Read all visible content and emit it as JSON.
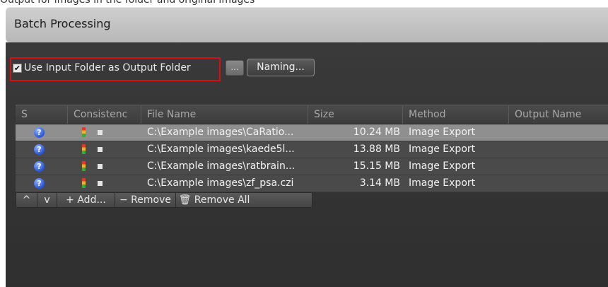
{
  "top_text": "Output for images in the folder and original images",
  "panel": {
    "title": "Batch Processing"
  },
  "options": {
    "checkbox_checked": true,
    "checkbox_label": "Use Input Folder as Output Folder",
    "browse_label": "...",
    "naming_label": "Naming..."
  },
  "table": {
    "columns": [
      "S",
      "Consistenc",
      "File Name",
      "Size",
      "Method",
      "Output Name"
    ],
    "rows": [
      {
        "file": "C:\\Example images\\CaRatio...",
        "size": "10.24 MB",
        "method": "Image Export",
        "output": ""
      },
      {
        "file": "C:\\Example images\\kaede5l...",
        "size": "13.88 MB",
        "method": "Image Export",
        "output": ""
      },
      {
        "file": "C:\\Example images\\ratbrain...",
        "size": "15.15 MB",
        "method": "Image Export",
        "output": ""
      },
      {
        "file": "C:\\Example images\\zf_psa.czi",
        "size": "3.14 MB",
        "method": "Image Export",
        "output": ""
      }
    ],
    "selected_row": 0
  },
  "toolbar": {
    "up": "^",
    "down": "v",
    "add": "+ Add...",
    "remove": "− Remove",
    "remove_all": "🗑 Remove All"
  },
  "icons": {
    "status": "question-icon",
    "consistency": "traffic-light-icon"
  },
  "colors": {
    "panel_bg": "#333333",
    "header_bg": "#c4c4c4",
    "selected_row": "#8f8f8f",
    "row_bg": "#4a4a4a",
    "highlight": "#d80f12"
  }
}
